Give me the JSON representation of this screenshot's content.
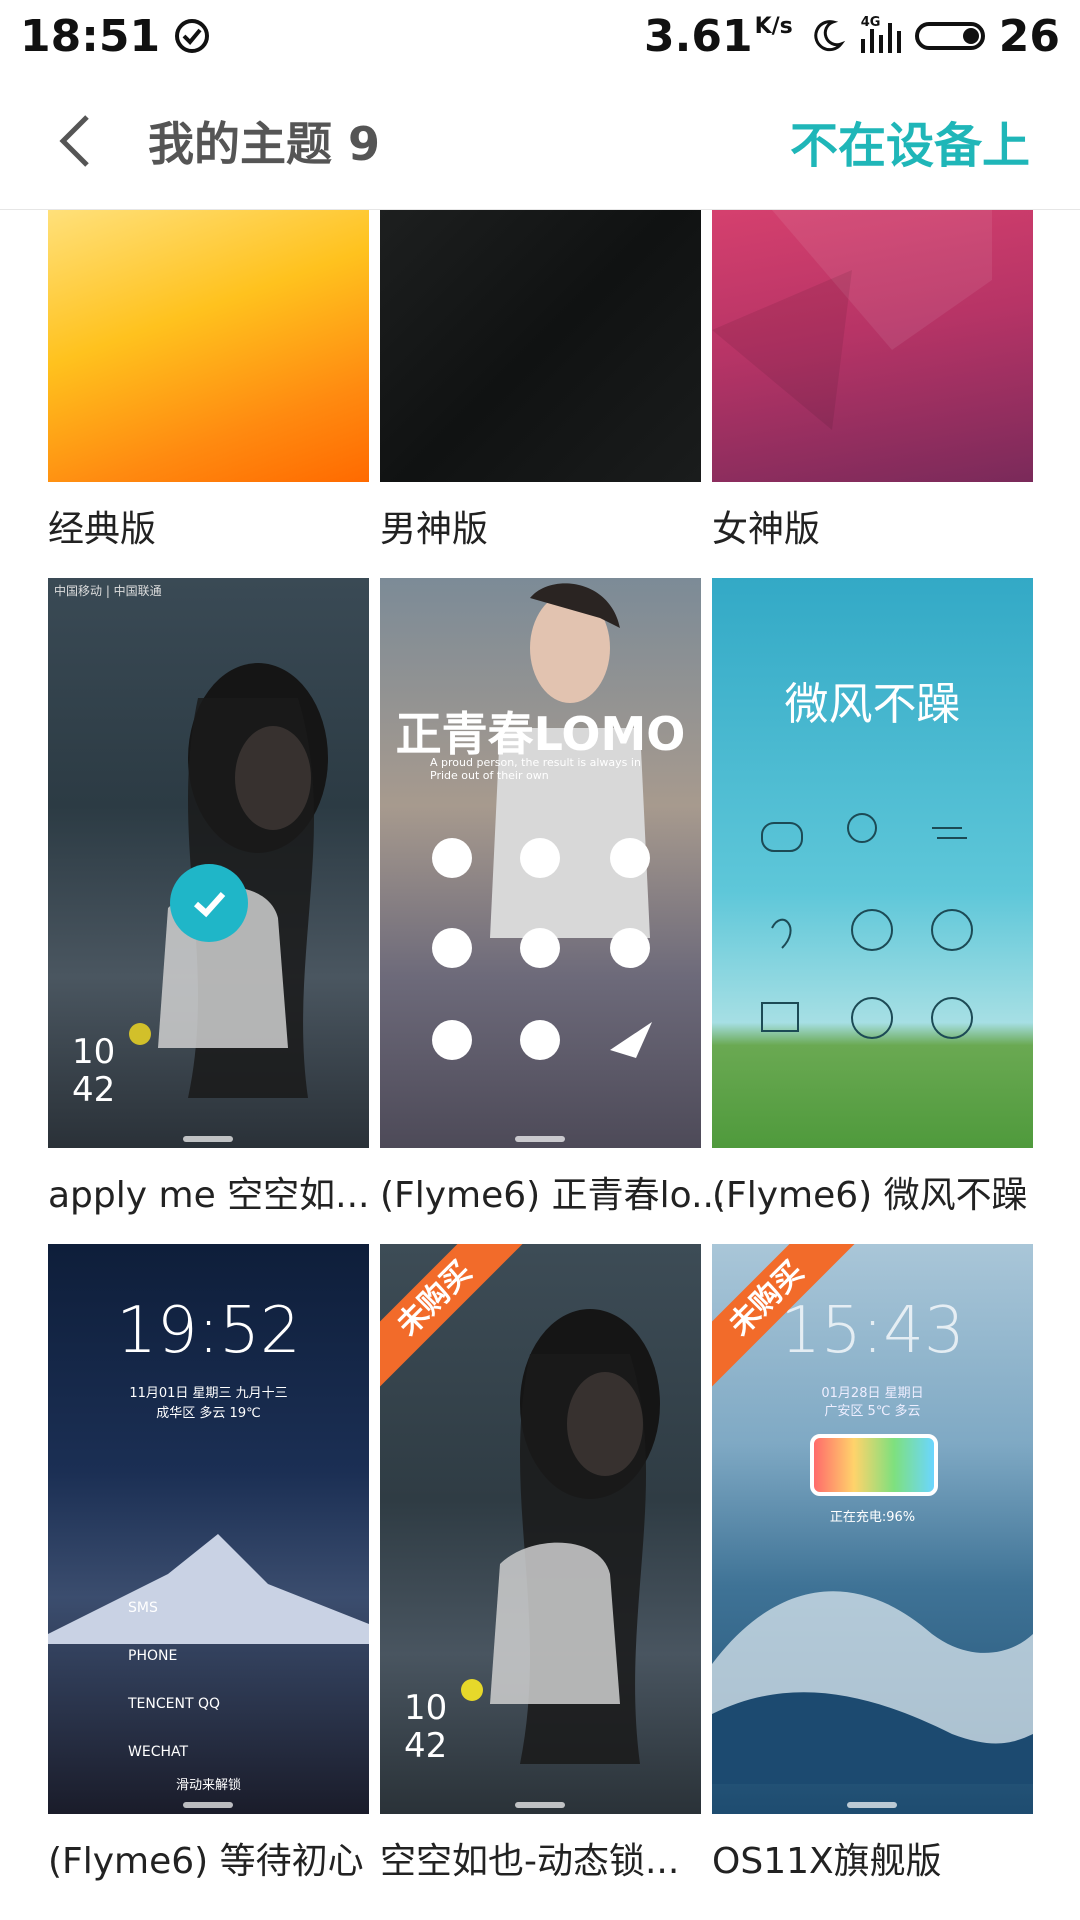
{
  "status_bar": {
    "time": "18:51",
    "net_speed": "3.61",
    "net_unit": "K/s",
    "signal": "4G",
    "battery": "26"
  },
  "header": {
    "title": "我的主题 9",
    "action": "不在设备上"
  },
  "themes": [
    {
      "label": "经典版"
    },
    {
      "label": "男神版"
    },
    {
      "label": "女神版"
    },
    {
      "label": "apply me 空空如...",
      "applied": true
    },
    {
      "label": "(Flyme6) 正青春lo..."
    },
    {
      "label": "(Flyme6) 微风不躁"
    },
    {
      "label": "(Flyme6) 等待初心"
    },
    {
      "label": "空空如也-动态锁...",
      "ribbon": "未购买"
    },
    {
      "label": "OS11X旗舰版",
      "ribbon": "未购买"
    }
  ],
  "previews": {
    "lomo_title": "正青春LOMO",
    "lomo_sub": "A proud person, the result is always in Pride out of their own",
    "breeze_title": "微风不躁",
    "waiting_time": "19:52",
    "waiting_date": "11月01日 星期三 九月十三",
    "waiting_weather": "成华区 多云 19℃",
    "waiting_unlock": "滑动来解锁",
    "waiting_items": [
      "SMS",
      "PHONE",
      "TENCENT QQ",
      "WECHAT"
    ],
    "os11_time": "15:43",
    "os11_date": "01月28日 星期日",
    "os11_weather": "广安区 5℃ 多云",
    "os11_charge": "正在充电:96%",
    "girl_clock": "10\n42"
  }
}
